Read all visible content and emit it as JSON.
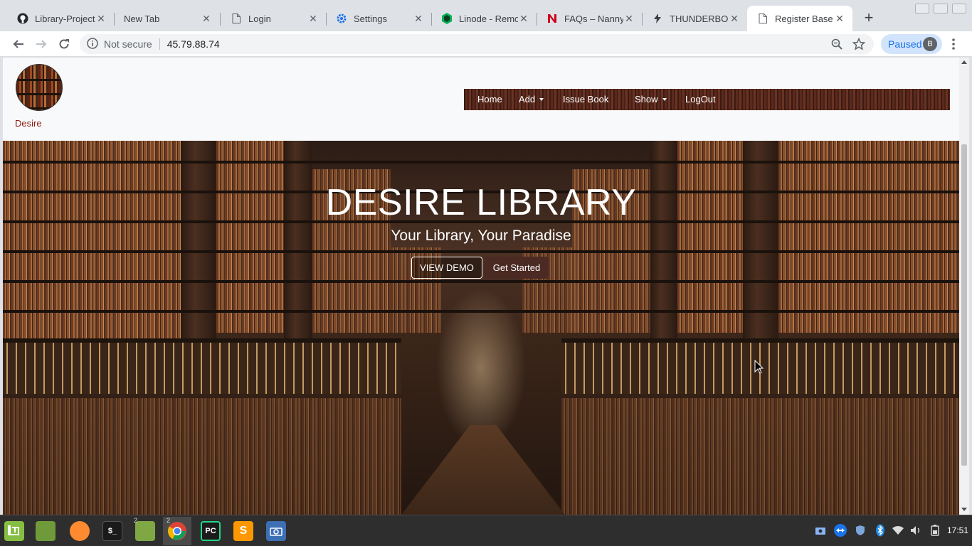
{
  "browser": {
    "tabs": [
      {
        "title": "Library-Project",
        "icon": "github-icon"
      },
      {
        "title": "New Tab",
        "icon": ""
      },
      {
        "title": "Login",
        "icon": "page-icon"
      },
      {
        "title": "Settings",
        "icon": "gear-icon"
      },
      {
        "title": "Linode - Remote",
        "icon": "linode-icon"
      },
      {
        "title": "FAQs – Nanny S",
        "icon": "n-logo-icon"
      },
      {
        "title": "THUNDERBOLT",
        "icon": "bolt-icon"
      },
      {
        "title": "Register Base",
        "icon": "page-icon",
        "active": true
      }
    ],
    "omnibox": {
      "security_label": "Not secure",
      "url": "45.79.88.74"
    },
    "profile": {
      "label": "Paused",
      "initial": "B"
    }
  },
  "site": {
    "brand_name": "Desire",
    "nav": {
      "home": "Home",
      "add": "Add",
      "issue_book": "Issue Book",
      "show": "Show",
      "logout": "LogOut"
    },
    "hero": {
      "title": "DESIRE LIBRARY",
      "subtitle": "Your Library, Your Paradise",
      "demo_button": "VIEW DEMO",
      "start_button": "Get Started"
    }
  },
  "taskbar": {
    "apps": [
      "mint-menu-icon",
      "files-icon",
      "firefox-icon",
      "terminal-icon",
      "folder-icon",
      "chrome-icon",
      "pycharm-icon",
      "sublime-icon",
      "screenshot-icon"
    ],
    "folder_badge": "2",
    "chrome_badge": "2",
    "clock": "17:51"
  },
  "colors": {
    "brand_text": "#8b1a10",
    "nav_bg": "#4a2016",
    "start_button_bg": "#4b2a23",
    "paused_chip": "#d2e3fc"
  }
}
